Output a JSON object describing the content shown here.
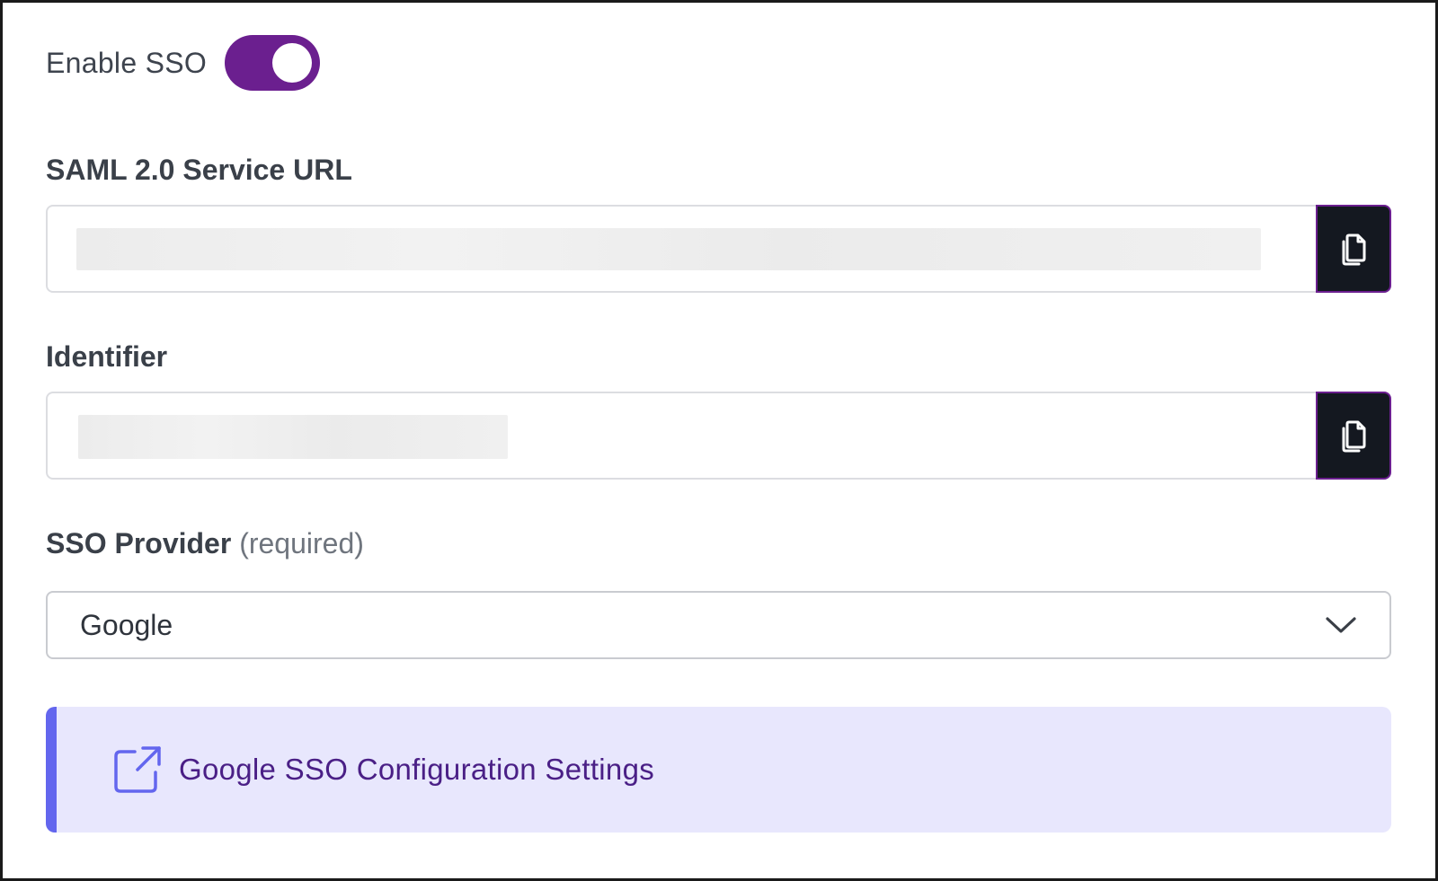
{
  "sso_toggle": {
    "label": "Enable SSO",
    "enabled": true,
    "color": "#6b1f8f"
  },
  "saml_url": {
    "label": "SAML 2.0 Service URL",
    "value_redacted": true,
    "copy_icon": "copy-icon"
  },
  "identifier": {
    "label": "Identifier",
    "value_redacted": true,
    "copy_icon": "copy-icon"
  },
  "sso_provider": {
    "label": "SSO Provider",
    "label_suffix": "(required)",
    "selected": "Google",
    "dropdown_icon": "chevron-down-icon"
  },
  "config_link": {
    "text": "Google SSO Configuration Settings",
    "icon": "external-link-icon",
    "accent_color": "#6366ee",
    "background_color": "#e8e7fd"
  }
}
